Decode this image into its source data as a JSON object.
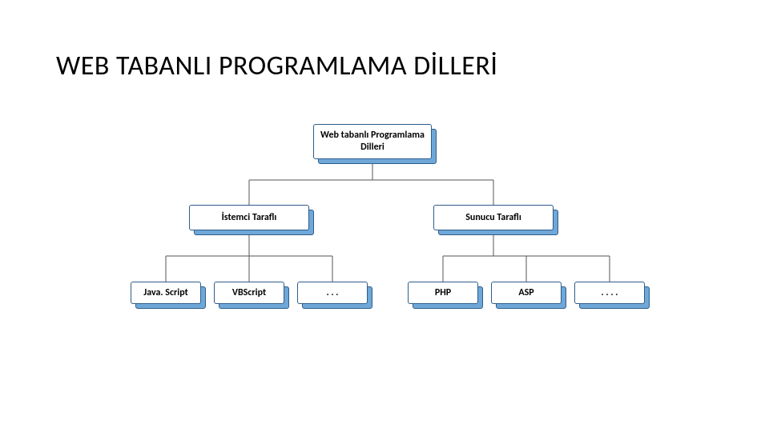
{
  "title": "WEB TABANLI PROGRAMLAMA DİLLERİ",
  "nodes": {
    "root": "Web tabanlı Programlama Dilleri",
    "client": "İstemci Taraflı",
    "server": "Sunucu Taraflı",
    "client_children": {
      "js": "Java. Script",
      "vbs": "VBScript",
      "etc": ". . ."
    },
    "server_children": {
      "php": "PHP",
      "asp": "ASP",
      "etc": ". . . ."
    }
  },
  "chart_data": {
    "type": "hierarchy",
    "title": "WEB TABANLI PROGRAMLAMA DİLLERİ",
    "root": {
      "label": "Web tabanlı Programlama Dilleri",
      "children": [
        {
          "label": "İstemci Taraflı",
          "children": [
            {
              "label": "Java. Script"
            },
            {
              "label": "VBScript"
            },
            {
              "label": ". . ."
            }
          ]
        },
        {
          "label": "Sunucu Taraflı",
          "children": [
            {
              "label": "PHP"
            },
            {
              "label": "ASP"
            },
            {
              "label": ". . . ."
            }
          ]
        }
      ]
    }
  }
}
